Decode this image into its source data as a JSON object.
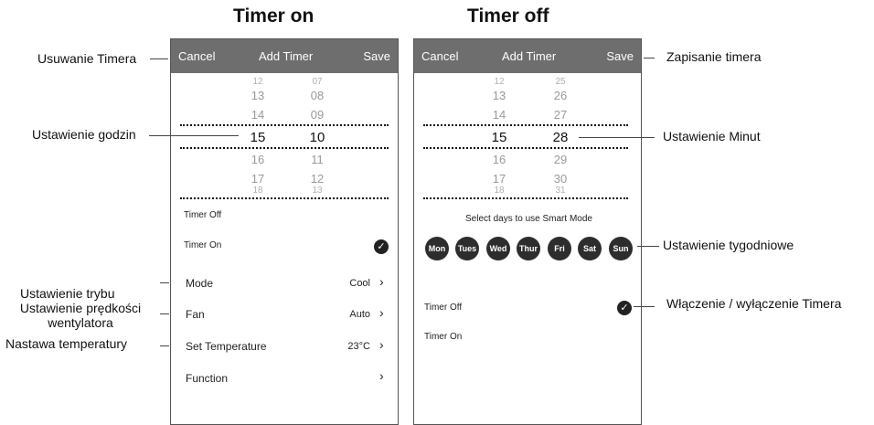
{
  "headings": {
    "left": "Timer on",
    "right": "Timer off"
  },
  "left_phone": {
    "topbar": {
      "cancel": "Cancel",
      "title": "Add Timer",
      "save": "Save"
    },
    "hours": [
      "12",
      "13",
      "14",
      "15",
      "16",
      "17",
      "18"
    ],
    "minutes": [
      "07",
      "08",
      "09",
      "10",
      "11",
      "12",
      "13"
    ],
    "rows": {
      "timer_off": "Timer Off",
      "timer_on": "Timer On",
      "mode": {
        "label": "Mode",
        "value": "Cool"
      },
      "fan": {
        "label": "Fan",
        "value": "Auto"
      },
      "set_temp": {
        "label": "Set Temperature",
        "value": "23°C"
      },
      "function": {
        "label": "Function"
      }
    },
    "selected_check": "timer_on"
  },
  "right_phone": {
    "topbar": {
      "cancel": "Cancel",
      "title": "Add Timer",
      "save": "Save"
    },
    "hours": [
      "12",
      "13",
      "14",
      "15",
      "16",
      "17",
      "18"
    ],
    "minutes": [
      "25",
      "26",
      "27",
      "28",
      "29",
      "30",
      "31"
    ],
    "days_caption": "Select days to use Smart Mode",
    "days": [
      "Mon",
      "Tues",
      "Wed",
      "Thur",
      "Fri",
      "Sat",
      "Sun"
    ],
    "rows": {
      "timer_off": "Timer Off",
      "timer_on": "Timer On"
    },
    "selected_check": "timer_off"
  },
  "annotations": {
    "remove_timer": "Usuwanie Timera",
    "set_hours": "Ustawienie godzin",
    "set_mode": "Ustawienie trybu",
    "set_fan": "Ustawienie prędkości wentylatora",
    "set_temp": "Nastawa temperatury",
    "save_timer": "Zapisanie timera",
    "set_minutes": "Ustawienie Minut",
    "weekly": "Ustawienie tygodniowe",
    "toggle_timer": "Włączenie / wyłączenie Timera"
  },
  "icons": {
    "chevron": "chevron-right-icon",
    "check": "check-circle-icon"
  }
}
